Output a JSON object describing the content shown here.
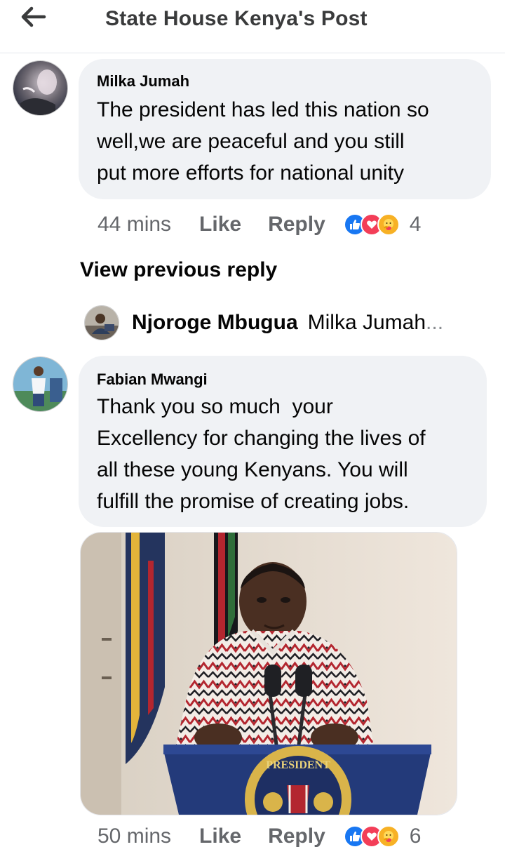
{
  "header": {
    "title": "State House Kenya's Post",
    "back_icon": "arrow-left-icon"
  },
  "comments": [
    {
      "author": "Milka Jumah",
      "lines": [
        "The president has led this nation so",
        "well,we are peaceful and you still",
        "put more efforts for national unity"
      ],
      "time": "44 mins",
      "like_label": "Like",
      "reply_label": "Reply",
      "reactions": [
        "like",
        "love",
        "care"
      ],
      "reaction_count": "4"
    },
    {
      "author": "Fabian Mwangi",
      "lines": [
        "Thank you so much  your",
        "Excellency for changing the lives of",
        "all these young Kenyans. You will",
        "fulfill the promise of creating jobs."
      ],
      "time": "50 mins",
      "like_label": "Like",
      "reply_label": "Reply",
      "reactions": [
        "like",
        "love",
        "care"
      ],
      "reaction_count": "6"
    }
  ],
  "view_previous": "View previous reply",
  "reply_preview": {
    "author": "Njoroge Mbugua",
    "text": "Milka Jumah",
    "ellipsis": "..."
  },
  "photo_seal_text": "PRESIDENT",
  "colors": {
    "accent": "#1877f2",
    "love": "#f33e58",
    "care": "#f7b125",
    "bubble": "#f0f2f5",
    "meta": "#65676b"
  }
}
